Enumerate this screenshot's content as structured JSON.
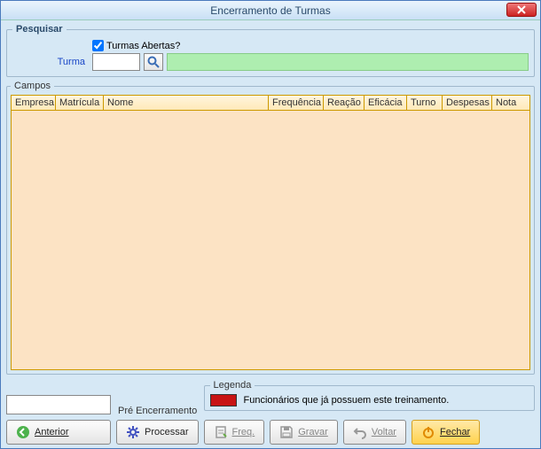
{
  "window": {
    "title": "Encerramento de Turmas"
  },
  "pesquisar": {
    "legend": "Pesquisar",
    "abertas_label": "Turmas Abertas?",
    "abertas_checked": true,
    "turma_label": "Turma",
    "turma_value": "",
    "turma_display": ""
  },
  "campos": {
    "legend": "Campos",
    "headers": {
      "empresa": "Empresa",
      "matricula": "Matrícula",
      "nome": "Nome",
      "frequencia": "Frequência",
      "reacao": "Reação",
      "eficacia": "Eficácia",
      "turno": "Turno",
      "despesas": "Despesas",
      "nota": "Nota"
    },
    "rows": []
  },
  "legenda": {
    "legend": "Legenda",
    "text": "Funcionários que já possuem este treinamento.",
    "color": "#c81414"
  },
  "pre_encerramento_label": "Pré Encerramento",
  "buttons": {
    "anterior": "Anterior",
    "processar": "Processar",
    "freq": "Freq.",
    "gravar": "Gravar",
    "voltar": "Voltar",
    "fechar": "Fechar"
  },
  "edit_value": ""
}
